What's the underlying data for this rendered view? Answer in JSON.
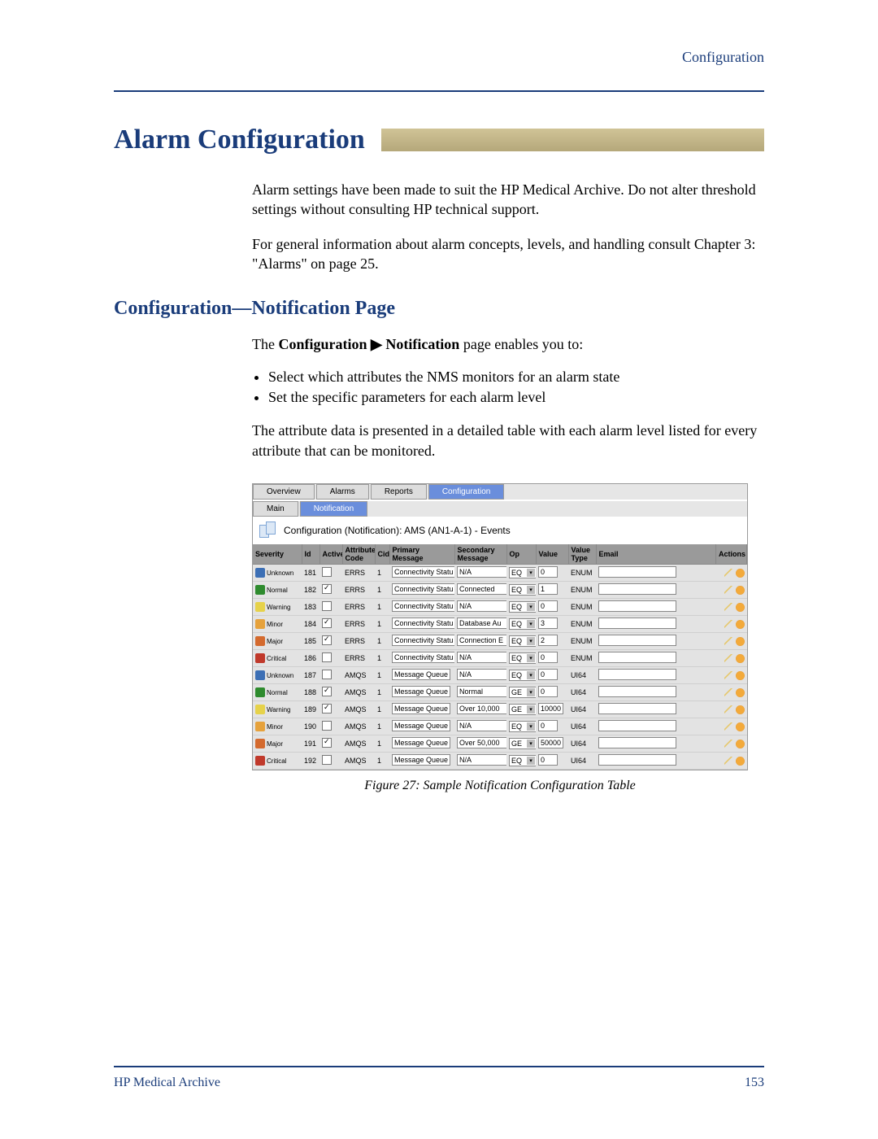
{
  "header": {
    "section": "Configuration"
  },
  "title": "Alarm Configuration",
  "intro1": "Alarm settings have been made to suit the HP Medical Archive. Do not alter threshold settings without consulting HP technical support.",
  "intro2": "For general information about alarm concepts, levels, and handling consult Chapter 3: \"Alarms\" on page 25.",
  "h2": "Configuration—Notification Page",
  "enables_lead_a": "The ",
  "enables_bold": "Configuration ▶ Notification",
  "enables_lead_b": " page enables you to:",
  "bullet1": "Select which attributes the NMS monitors for an alarm state",
  "bullet2": "Set the specific parameters for each alarm level",
  "para3": "The attribute data is presented in a detailed table with each alarm level listed for every attribute that can be monitored.",
  "figure": {
    "tabs": {
      "overview": "Overview",
      "alarms": "Alarms",
      "reports": "Reports",
      "configuration": "Configuration"
    },
    "subtabs": {
      "main": "Main",
      "notification": "Notification"
    },
    "banner": "Configuration (Notification): AMS (AN1-A-1) - Events",
    "cols": {
      "severity": "Severity",
      "id": "Id",
      "active": "Active",
      "attr": "Attribute Code",
      "cid": "Cid",
      "primary": "Primary Message",
      "secondary": "Secondary Message",
      "op": "Op",
      "value": "Value",
      "vtype": "Value Type",
      "email": "Email",
      "actions": "Actions"
    },
    "rows": [
      {
        "sev": "Unknown",
        "sevClass": "sev-unknown",
        "id": "181",
        "active": false,
        "attr": "ERRS",
        "cid": "1",
        "prim": "Connectivity Statu",
        "sec": "N/A",
        "op": "EQ",
        "val": "0",
        "vtype": "ENUM"
      },
      {
        "sev": "Normal",
        "sevClass": "sev-normal",
        "id": "182",
        "active": true,
        "attr": "ERRS",
        "cid": "1",
        "prim": "Connectivity Statu",
        "sec": "Connected",
        "op": "EQ",
        "val": "1",
        "vtype": "ENUM"
      },
      {
        "sev": "Warning",
        "sevClass": "sev-warning",
        "id": "183",
        "active": false,
        "attr": "ERRS",
        "cid": "1",
        "prim": "Connectivity Statu",
        "sec": "N/A",
        "op": "EQ",
        "val": "0",
        "vtype": "ENUM"
      },
      {
        "sev": "Minor",
        "sevClass": "sev-minor",
        "id": "184",
        "active": true,
        "attr": "ERRS",
        "cid": "1",
        "prim": "Connectivity Statu",
        "sec": "Database Au",
        "op": "EQ",
        "val": "3",
        "vtype": "ENUM"
      },
      {
        "sev": "Major",
        "sevClass": "sev-major",
        "id": "185",
        "active": true,
        "attr": "ERRS",
        "cid": "1",
        "prim": "Connectivity Statu",
        "sec": "Connection E",
        "op": "EQ",
        "val": "2",
        "vtype": "ENUM"
      },
      {
        "sev": "Critical",
        "sevClass": "sev-critical",
        "id": "186",
        "active": false,
        "attr": "ERRS",
        "cid": "1",
        "prim": "Connectivity Statu",
        "sec": "N/A",
        "op": "EQ",
        "val": "0",
        "vtype": "ENUM"
      },
      {
        "sev": "Unknown",
        "sevClass": "sev-unknown",
        "id": "187",
        "active": false,
        "attr": "AMQS",
        "cid": "1",
        "prim": "Message Queue",
        "sec": "N/A",
        "op": "EQ",
        "val": "0",
        "vtype": "UI64"
      },
      {
        "sev": "Normal",
        "sevClass": "sev-normal",
        "id": "188",
        "active": true,
        "attr": "AMQS",
        "cid": "1",
        "prim": "Message Queue",
        "sec": "Normal",
        "op": "GE",
        "val": "0",
        "vtype": "UI64"
      },
      {
        "sev": "Warning",
        "sevClass": "sev-warning",
        "id": "189",
        "active": true,
        "attr": "AMQS",
        "cid": "1",
        "prim": "Message Queue",
        "sec": "Over 10,000",
        "op": "GE",
        "val": "10000",
        "vtype": "UI64"
      },
      {
        "sev": "Minor",
        "sevClass": "sev-minor",
        "id": "190",
        "active": false,
        "attr": "AMQS",
        "cid": "1",
        "prim": "Message Queue",
        "sec": "N/A",
        "op": "EQ",
        "val": "0",
        "vtype": "UI64"
      },
      {
        "sev": "Major",
        "sevClass": "sev-major",
        "id": "191",
        "active": true,
        "attr": "AMQS",
        "cid": "1",
        "prim": "Message Queue",
        "sec": "Over 50,000",
        "op": "GE",
        "val": "50000",
        "vtype": "UI64"
      },
      {
        "sev": "Critical",
        "sevClass": "sev-critical",
        "id": "192",
        "active": false,
        "attr": "AMQS",
        "cid": "1",
        "prim": "Message Queue",
        "sec": "N/A",
        "op": "EQ",
        "val": "0",
        "vtype": "UI64"
      }
    ],
    "caption": "Figure 27: Sample Notification Configuration Table"
  },
  "footer": {
    "left": "HP Medical Archive",
    "right": "153"
  }
}
